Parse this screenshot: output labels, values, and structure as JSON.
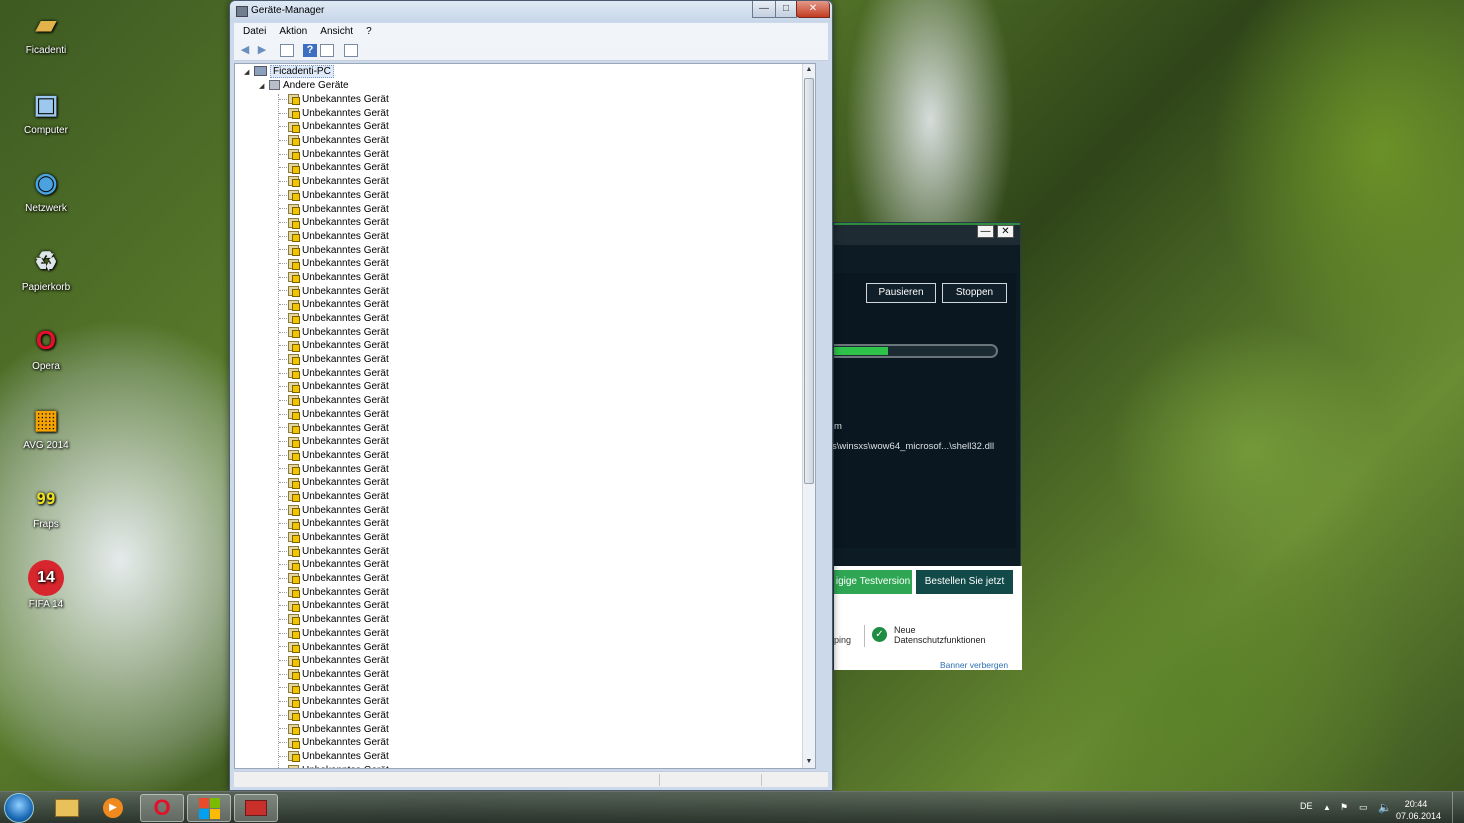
{
  "desktop": {
    "icons": [
      {
        "label": "Ficadenti",
        "icon": "user-folder-icon"
      },
      {
        "label": "Computer",
        "icon": "computer-icon"
      },
      {
        "label": "Netzwerk",
        "icon": "network-globe-icon"
      },
      {
        "label": "Papierkorb",
        "icon": "recycle-bin-icon"
      },
      {
        "label": "Opera",
        "icon": "opera-icon"
      },
      {
        "label": "AVG 2014",
        "icon": "avg-icon"
      },
      {
        "label": "Fraps",
        "icon": "fraps-icon"
      },
      {
        "label": "FIFA 14",
        "icon": "fifa-icon"
      }
    ]
  },
  "device_manager": {
    "title": "Geräte-Manager",
    "window_buttons": {
      "minimize": "—",
      "maximize": "□",
      "close": "✕"
    },
    "menu": [
      "Datei",
      "Aktion",
      "Ansicht",
      "?"
    ],
    "toolbar_icons": [
      "back-arrow-icon",
      "forward-arrow-icon",
      "properties-icon",
      "help-icon",
      "view-icon",
      "scan-hardware-icon"
    ],
    "tree": {
      "root": "Ficadenti-PC",
      "group": "Andere Geräte",
      "device_label": "Unbekanntes Gerät",
      "device_count": 50
    }
  },
  "avg_scan": {
    "buttons": {
      "pause": "Pausieren",
      "stop": "Stoppen"
    },
    "progress": 0.33,
    "partial_text": "m",
    "file_path": "s\\winsxs\\wow64_microsof...\\shell32.dll",
    "banner": {
      "trial_button": "igige Testversion",
      "order_button": "Bestellen Sie jetzt",
      "partial_left": "ping",
      "feature_line1": "Neue",
      "feature_line2": "Datenschutzfunktionen",
      "hide_link": "Banner verbergen"
    },
    "window_buttons": {
      "minimize": "—",
      "close": "✕"
    }
  },
  "taskbar": {
    "language": "DE",
    "time": "20:44",
    "date": "07.06.2014"
  }
}
